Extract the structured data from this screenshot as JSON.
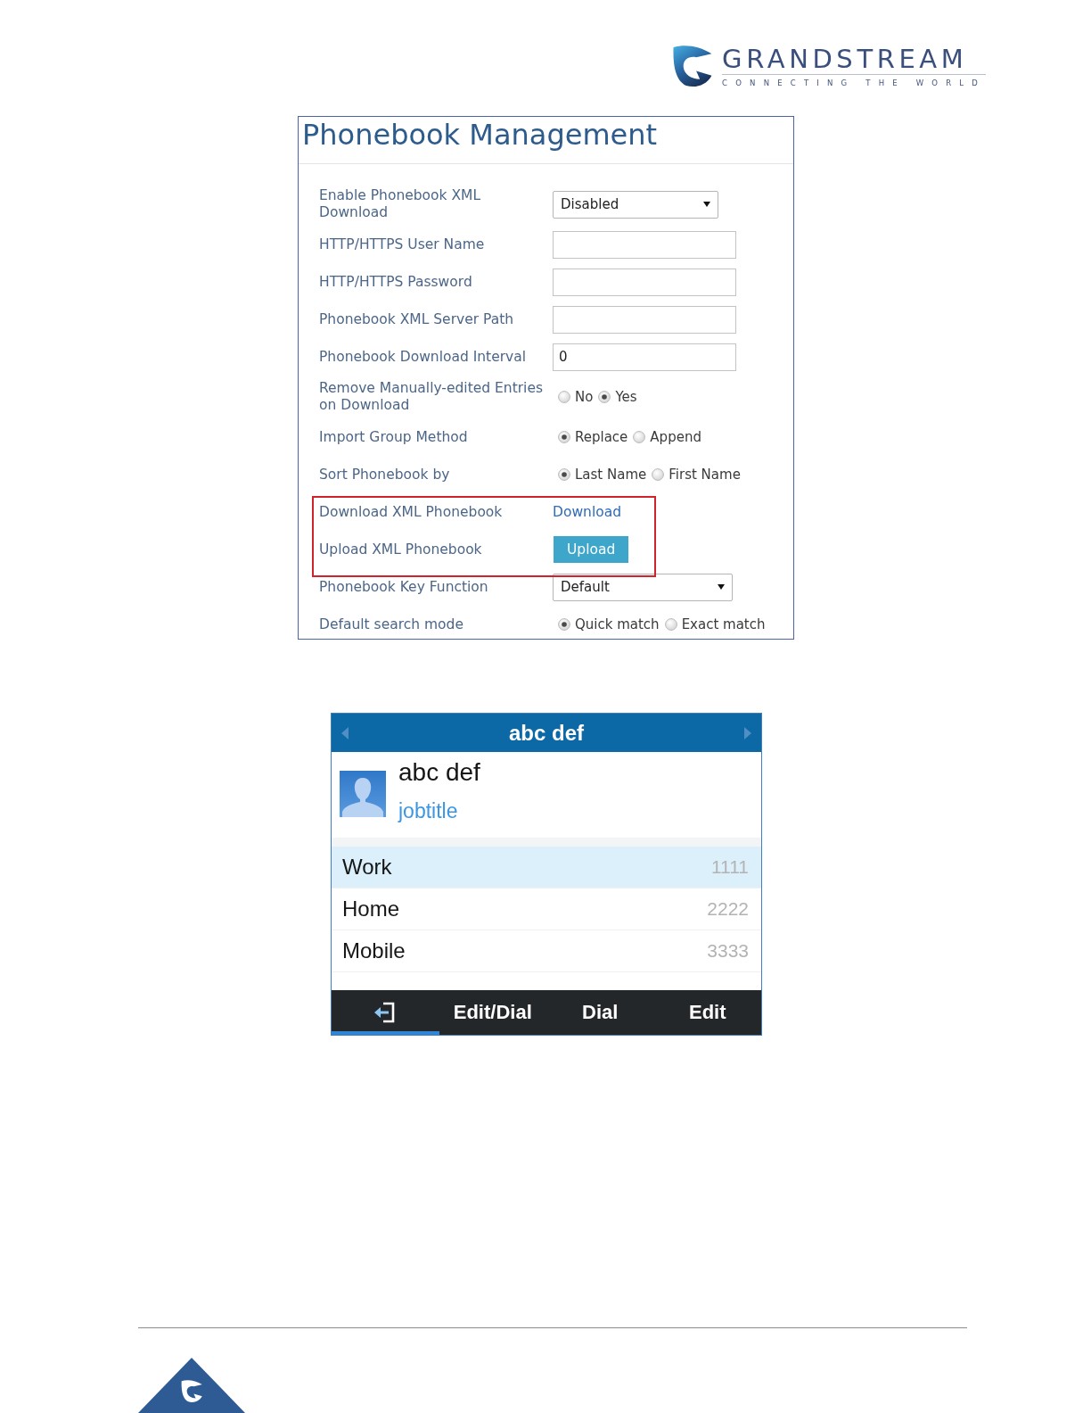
{
  "logo": {
    "wordmark": "GRANDSTREAM",
    "tagline": "CONNECTING THE WORLD"
  },
  "settings_panel": {
    "title": "Phonebook Management",
    "rows": [
      {
        "kind": "select",
        "label": "Enable Phonebook XML Download",
        "value": "Disabled",
        "highlighted": false
      },
      {
        "kind": "input",
        "label": "HTTP/HTTPS User Name",
        "highlighted": false
      },
      {
        "kind": "input",
        "label": "HTTP/HTTPS Password",
        "highlighted": false
      },
      {
        "kind": "input",
        "label": "Phonebook XML Server Path",
        "highlighted": false
      },
      {
        "kind": "input",
        "label": "Phonebook Download Interval",
        "value": "0",
        "highlighted": false
      },
      {
        "kind": "radio",
        "label": "Remove Manually-edited Entries on Download",
        "options": [
          {
            "label": "No",
            "selected": false
          },
          {
            "label": "Yes",
            "selected": true
          }
        ],
        "highlighted": false
      },
      {
        "kind": "radio",
        "label": "Import Group Method",
        "options": [
          {
            "label": "Replace",
            "selected": true
          },
          {
            "label": "Append",
            "selected": false
          }
        ],
        "highlighted": false
      },
      {
        "kind": "radio",
        "label": "Sort Phonebook by",
        "options": [
          {
            "label": "Last Name",
            "selected": true
          },
          {
            "label": "First Name",
            "selected": false
          }
        ],
        "highlighted": false
      },
      {
        "kind": "link",
        "label": "Download XML Phonebook",
        "link": "Download",
        "highlighted": true
      },
      {
        "kind": "button",
        "label": "Upload XML Phonebook",
        "button": "Upload",
        "highlighted": true
      },
      {
        "kind": "select",
        "label": "Phonebook Key Function",
        "value": "Default",
        "highlighted": false
      },
      {
        "kind": "radio",
        "label": "Default search mode",
        "options": [
          {
            "label": "Quick match",
            "selected": true
          },
          {
            "label": "Exact match",
            "selected": false
          }
        ],
        "highlighted": false
      }
    ]
  },
  "phone_screen": {
    "title": "abc def",
    "contact": {
      "name": "abc def",
      "job_title": "jobtitle"
    },
    "numbers": [
      {
        "label": "Work",
        "number": "1111",
        "selected": true
      },
      {
        "label": "Home",
        "number": "2222",
        "selected": false
      },
      {
        "label": "Mobile",
        "number": "3333",
        "selected": false
      }
    ],
    "softkeys": [
      {
        "kind": "icon",
        "selected": true
      },
      {
        "kind": "text",
        "label": "Edit/Dial",
        "selected": false
      },
      {
        "kind": "text",
        "label": "Dial",
        "selected": false
      },
      {
        "kind": "text",
        "label": "Edit",
        "selected": false
      }
    ]
  }
}
